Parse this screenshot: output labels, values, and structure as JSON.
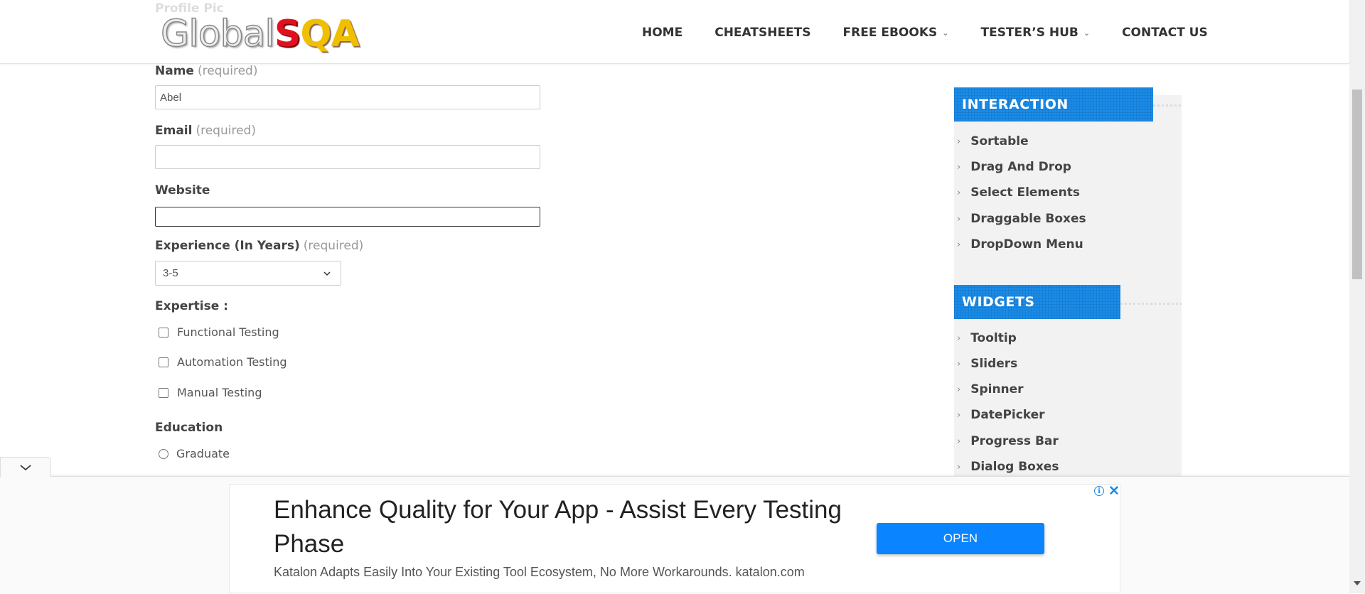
{
  "header": {
    "ghost_label": "Profile Pic",
    "logo": {
      "global": "Global",
      "s": "S",
      "qa": "QA"
    },
    "nav": [
      {
        "label": "HOME",
        "dropdown": false
      },
      {
        "label": "CHEATSHEETS",
        "dropdown": false
      },
      {
        "label": "FREE EBOOKS",
        "dropdown": true
      },
      {
        "label": "TESTER’S HUB",
        "dropdown": true
      },
      {
        "label": "CONTACT US",
        "dropdown": false
      }
    ]
  },
  "form": {
    "name_label": "Name",
    "name_required": "(required)",
    "name_value": "Abel",
    "email_label": "Email",
    "email_required": "(required)",
    "email_value": "",
    "website_label": "Website",
    "website_value": "",
    "experience_label": "Experience (In Years)",
    "experience_required": "(required)",
    "experience_value": "3-5",
    "expertise_label": "Expertise :",
    "expertise_options": [
      "Functional Testing",
      "Automation Testing",
      "Manual Testing"
    ],
    "education_label": "Education",
    "education_options": [
      "Graduate"
    ]
  },
  "sidebar": {
    "interaction_title": "INTERACTION",
    "interaction_items": [
      "Sortable",
      "Drag And Drop",
      "Select Elements",
      "Draggable Boxes",
      "DropDown Menu"
    ],
    "widgets_title": "WIDGETS",
    "widgets_items": [
      "Tooltip",
      "Sliders",
      "Spinner",
      "DatePicker",
      "Progress Bar",
      "Dialog Boxes"
    ]
  },
  "ad": {
    "title": "Enhance Quality for Your App - Assist Every Testing Phase",
    "subtitle": "Katalon Adapts Easily Into Your Existing Tool Ecosystem, No More Workarounds. katalon.com",
    "button": "OPEN",
    "info": "i",
    "close": "✕"
  },
  "colors": {
    "accent_blue": "#1a8be8",
    "button_blue": "#0a84ff"
  }
}
